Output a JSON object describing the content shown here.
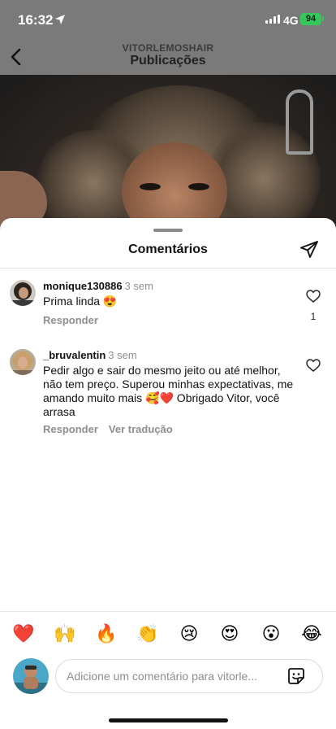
{
  "status_bar": {
    "time": "16:32",
    "network": "4G",
    "battery": "94"
  },
  "header": {
    "username": "VITORLEMOSHAIR",
    "title": "Publicações"
  },
  "sheet": {
    "title": "Comentários"
  },
  "comments": [
    {
      "username": "monique130886",
      "time": "3 sem",
      "text": "Prima linda 😍",
      "reply_label": "Responder",
      "likes": "1"
    },
    {
      "username": "_bruvalentin",
      "time": "3 sem",
      "text": "Pedir algo e sair do mesmo jeito ou até melhor, não tem preço. Superou minhas expectativas, me amando muito mais 🥰❤️ Obrigado Vitor, você arrasa",
      "reply_label": "Responder",
      "translate_label": "Ver tradução"
    }
  ],
  "quick_reactions": [
    "❤️",
    "🙌",
    "🔥",
    "👏",
    "😢",
    "😍",
    "😮",
    "😂"
  ],
  "comment_input": {
    "placeholder": "Adicione um comentário para vitorle..."
  },
  "colors": {
    "battery": "#35c759",
    "secondary_text": "#8e8e8e"
  }
}
